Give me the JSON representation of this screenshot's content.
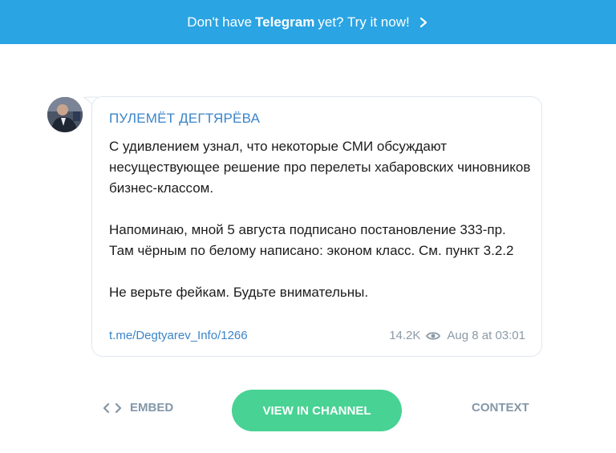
{
  "banner": {
    "prefix": "Don't have",
    "brand": "Telegram",
    "suffix": "yet? Try it now!",
    "icon": "chevron-right-icon",
    "color": "#2aa4e3"
  },
  "post": {
    "channel_name": "ПУЛЕМЁТ ДЕГТЯРЁВА",
    "paragraphs": [
      "С удивлением узнал, что некоторые СМИ обсуждают несуществующее решение про перелеты хабаровских чиновников бизнес-классом.",
      "Напоминаю, мной 5 августа подписано постановление 333-пр. Там чёрным по белому написано: эконом класс. См. пункт 3.2.2",
      "Не верьте фейкам. Будьте внимательны."
    ],
    "link": "t.me/Degtyarev_Info/1266",
    "views": "14.2K",
    "date": "Aug 8 at 03:01"
  },
  "actions": {
    "embed": "EMBED",
    "view_in_channel": "VIEW IN CHANNEL",
    "context": "CONTEXT",
    "accent": "#48d294"
  }
}
